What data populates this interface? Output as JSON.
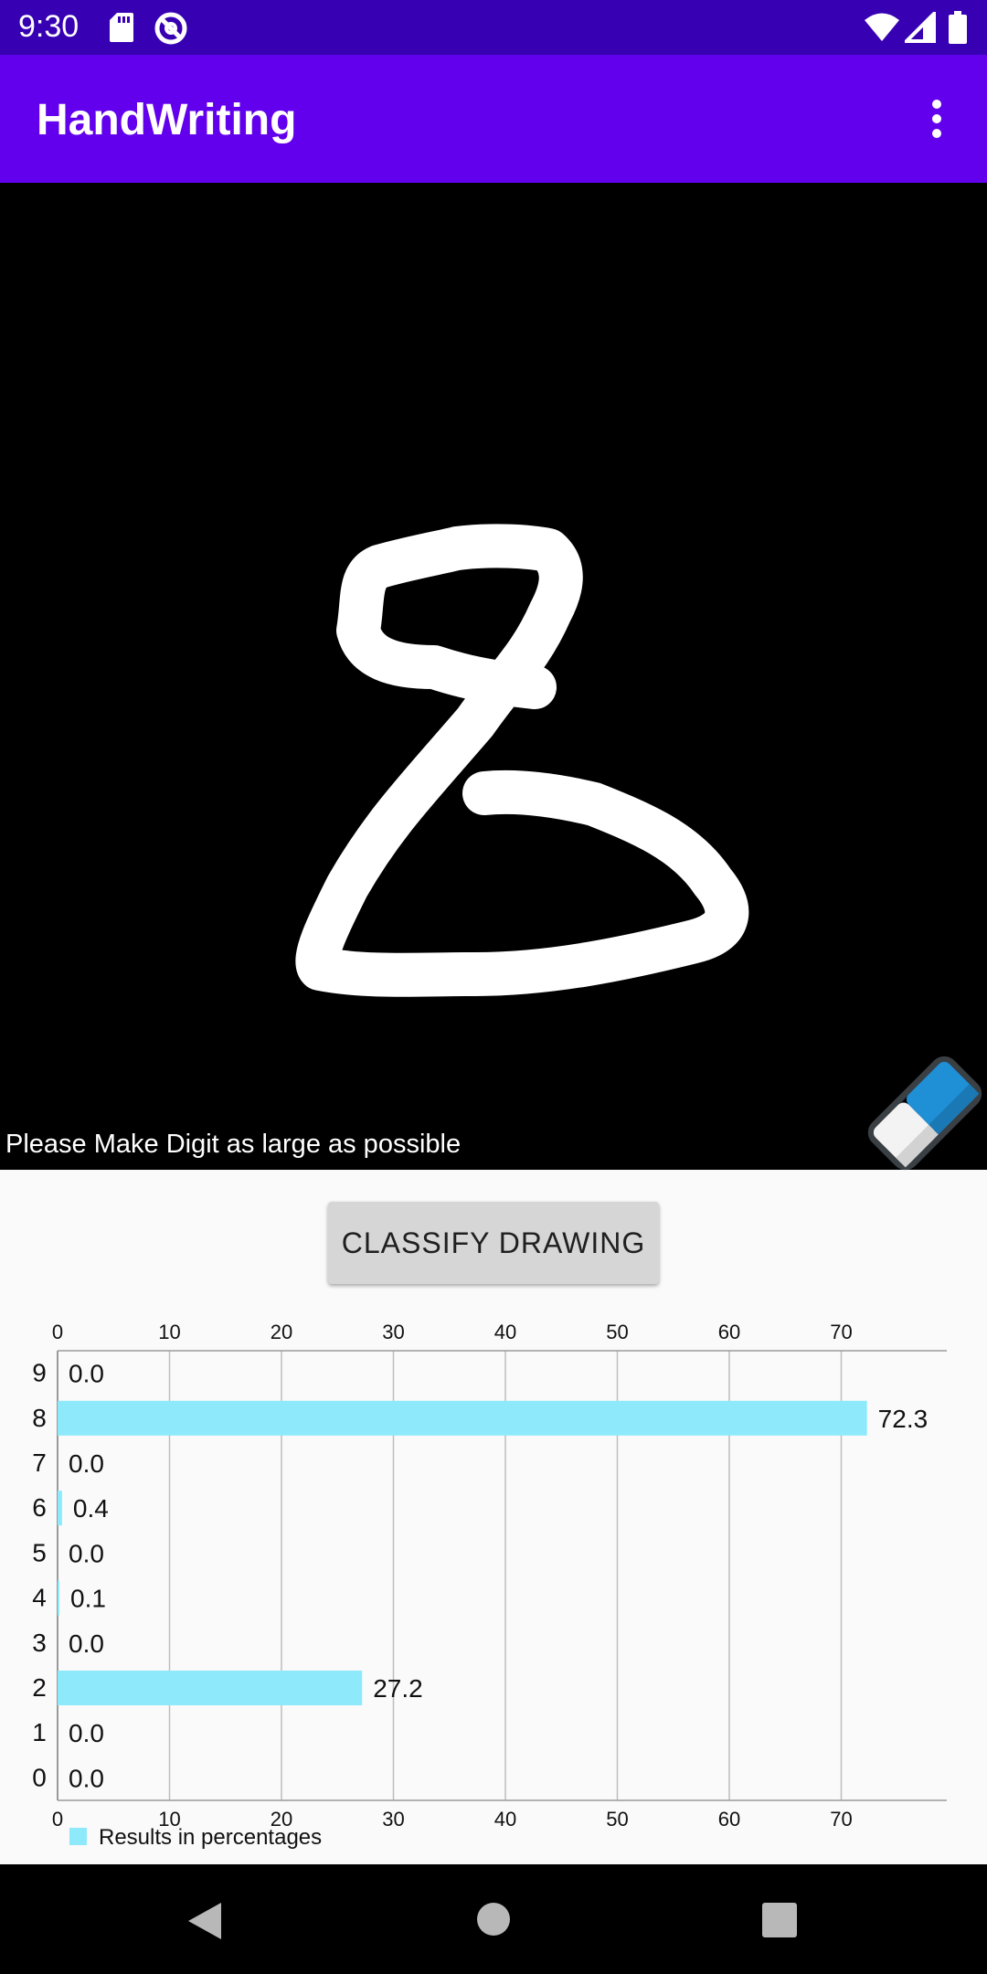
{
  "status_bar": {
    "time": "9:30",
    "icons": [
      "sd-card-icon",
      "sync-icon",
      "wifi-icon",
      "signal-icon",
      "battery-icon"
    ]
  },
  "app_bar": {
    "title": "HandWriting",
    "menu_icon": "overflow-menu-icon"
  },
  "canvas": {
    "hint": "Please Make Digit as large as possible",
    "tool_icon": "eraser-icon"
  },
  "classify_button": {
    "label": "CLASSIFY DRAWING"
  },
  "chart_data": {
    "type": "bar",
    "orientation": "horizontal",
    "categories": [
      "0",
      "1",
      "2",
      "3",
      "4",
      "5",
      "6",
      "7",
      "8",
      "9"
    ],
    "values": [
      0.0,
      0.0,
      27.2,
      0.0,
      0.1,
      0.0,
      0.4,
      0.0,
      72.3,
      0.0
    ],
    "value_labels": [
      "0.0",
      "0.0",
      "27.2",
      "0.0",
      "0.1",
      "0.0",
      "0.4",
      "0.0",
      "72.3",
      "0.0"
    ],
    "series": [
      {
        "name": "Results in percentages",
        "values": [
          0.0,
          0.0,
          27.2,
          0.0,
          0.1,
          0.0,
          0.4,
          0.0,
          72.3,
          0.0
        ]
      }
    ],
    "xticks": [
      "0",
      "10",
      "20",
      "30",
      "40",
      "50",
      "60",
      "70"
    ],
    "xlim": [
      0,
      79.5
    ],
    "grid": true,
    "legend": "bottom-left",
    "bar_color": "#8eeafb"
  },
  "colors": {
    "status_bar": "#3700b3",
    "app_bar": "#6200ee",
    "canvas": "#000000",
    "ink": "#ffffff"
  },
  "nav_bar": {
    "icons": [
      "back-icon",
      "home-icon",
      "recents-icon"
    ]
  }
}
